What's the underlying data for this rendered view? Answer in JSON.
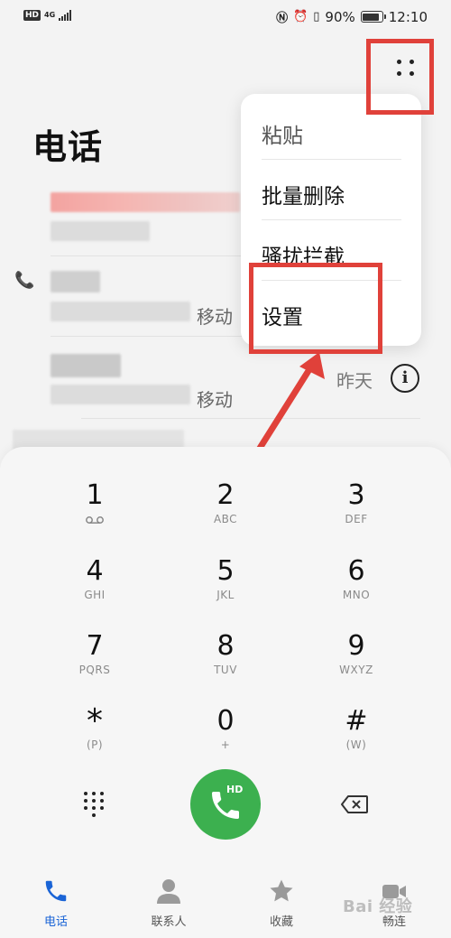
{
  "status_bar": {
    "left_badges": [
      "HD",
      "4G"
    ],
    "battery_percent": "90%",
    "time": "12:10",
    "icons": [
      "nfc-icon",
      "alarm-icon",
      "vibrate-icon",
      "battery-icon"
    ]
  },
  "header": {
    "title": "电话",
    "more_icon": "more-dots-icon"
  },
  "call_log": {
    "items": [
      {
        "carrier": ""
      },
      {
        "carrier": "移动"
      },
      {
        "carrier": "移动",
        "time": "昨天",
        "info_icon": "info-icon"
      },
      {
        "carrier": ""
      }
    ]
  },
  "popup_menu": {
    "items": [
      "粘贴",
      "批量删除",
      "骚扰拦截",
      "设置"
    ]
  },
  "dialpad": {
    "keys": [
      {
        "digit": "1",
        "sub": ""
      },
      {
        "digit": "2",
        "sub": "ABC"
      },
      {
        "digit": "3",
        "sub": "DEF"
      },
      {
        "digit": "4",
        "sub": "GHI"
      },
      {
        "digit": "5",
        "sub": "JKL"
      },
      {
        "digit": "6",
        "sub": "MNO"
      },
      {
        "digit": "7",
        "sub": "PQRS"
      },
      {
        "digit": "8",
        "sub": "TUV"
      },
      {
        "digit": "9",
        "sub": "WXYZ"
      },
      {
        "digit": "*",
        "sub": "(P)"
      },
      {
        "digit": "0",
        "sub": "+"
      },
      {
        "digit": "#",
        "sub": "(W)"
      }
    ],
    "call_badge": "HD",
    "call_color": "#3cb04f"
  },
  "bottom_nav": {
    "tabs": [
      {
        "label": "电话",
        "icon": "phone-icon",
        "active": true
      },
      {
        "label": "联系人",
        "icon": "contacts-icon",
        "active": false
      },
      {
        "label": "收藏",
        "icon": "star-icon",
        "active": false
      },
      {
        "label": "畅连",
        "icon": "video-icon",
        "active": false
      }
    ],
    "active_color": "#1a64d6"
  },
  "annotations": {
    "highlight_color": "#e0413a"
  },
  "watermark": "Bai 经验"
}
